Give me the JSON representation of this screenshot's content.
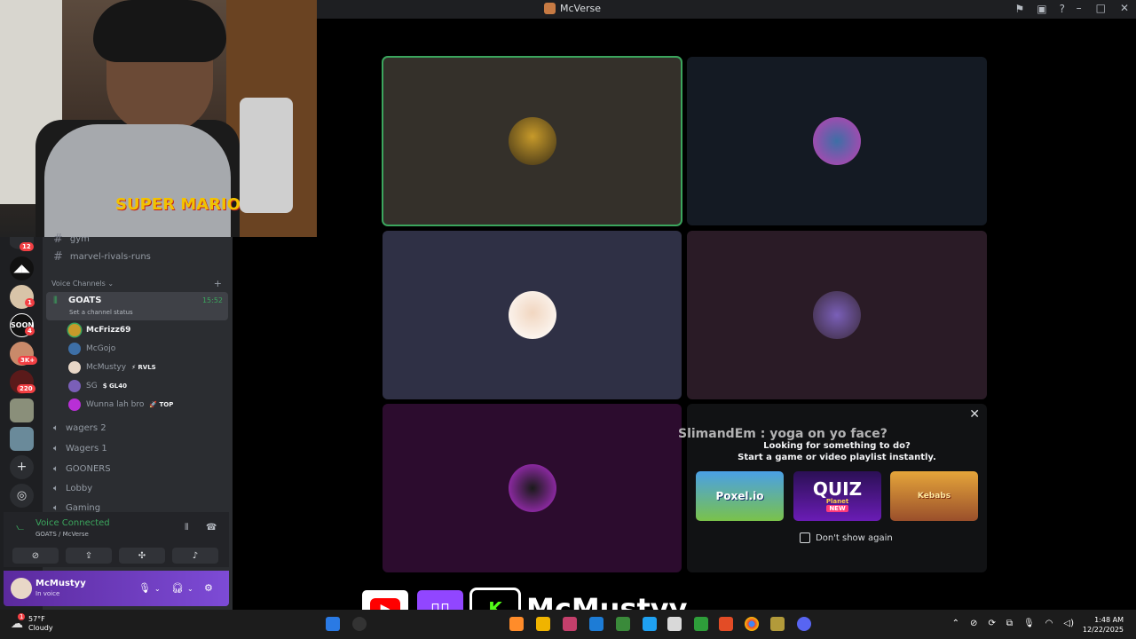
{
  "window": {
    "title": "McVerse",
    "toolbar_icons": [
      "inbox-flag-icon",
      "screen-share-icon",
      "help-icon"
    ],
    "controls": [
      "minimize-icon",
      "maximize-icon",
      "close-icon"
    ]
  },
  "sidebar": {
    "channels": [
      {
        "name": "gym"
      },
      {
        "name": "marvel-rivals-runs"
      }
    ],
    "voice_header": "Voice Channels",
    "active_voice": {
      "name": "GOATS",
      "status_placeholder": "Set a channel status",
      "timer": "15:52",
      "members": [
        {
          "name": "McFrizz69",
          "tag": "",
          "speaking": true
        },
        {
          "name": "McGojo",
          "tag": ""
        },
        {
          "name": "McMustyy",
          "tag": "⚡ RVLS"
        },
        {
          "name": "SG",
          "tag": "$ GL40"
        },
        {
          "name": "Wunna lah bro",
          "tag": "🚀 TOP"
        }
      ]
    },
    "other_voice": [
      {
        "name": "wagers 2"
      },
      {
        "name": "Wagers 1"
      },
      {
        "name": "GOONERS"
      },
      {
        "name": "Lobby"
      },
      {
        "name": "Gaming"
      }
    ]
  },
  "server_rail": {
    "badges": [
      "12",
      "1",
      "4",
      "3K+",
      "220"
    ]
  },
  "voice_panel": {
    "title": "Voice Connected",
    "subtitle": "GOATS / McVerse"
  },
  "user_panel": {
    "username": "McMustyy",
    "status": "In voice"
  },
  "activity": {
    "chat_overlay": "SlimandEm : yoga on yo face?",
    "title": "Looking for something to do?",
    "subtitle": "Start a game or video playlist instantly.",
    "games": [
      "Poxel.io",
      "QUIZ",
      "Kebabs"
    ],
    "quiz_sub": "Planet",
    "quiz_badge": "NEW",
    "dont_show": "Don't show again"
  },
  "overlay": {
    "handle": "McMustyy",
    "kick_letter": "K"
  },
  "taskbar": {
    "temp": "57°F",
    "condition": "Cloudy",
    "time": "1:48 AM",
    "date": "12/22/2025",
    "weather_badge": "1"
  },
  "colors": {
    "accent_green": "#3ba55d",
    "nitro_purple": "#7d4bd6",
    "twitch": "#9146ff",
    "youtube": "#ff0000",
    "kick": "#53fc18"
  }
}
